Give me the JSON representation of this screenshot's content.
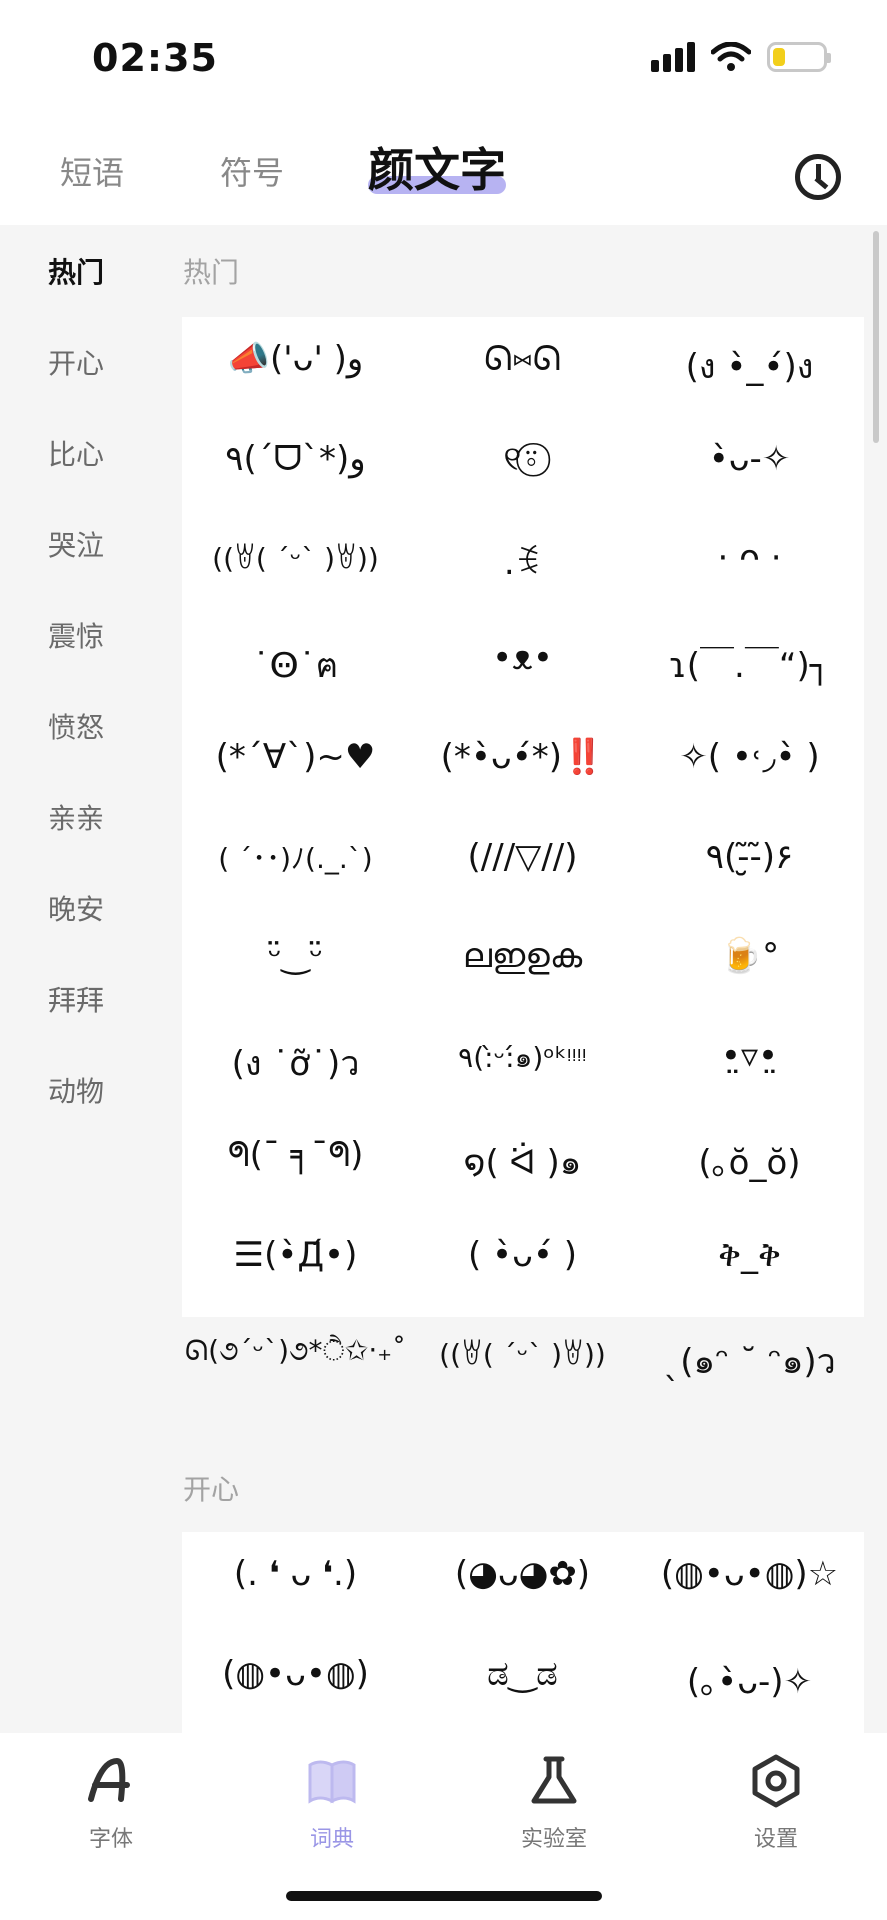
{
  "status": {
    "time": "02:35"
  },
  "tabs": {
    "phrases": "短语",
    "symbols": "符号",
    "kaomoji": "颜文字"
  },
  "sidebar": {
    "items": [
      "热门",
      "开心",
      "比心",
      "哭泣",
      "震惊",
      "愤怒",
      "亲亲",
      "晚安",
      "拜拜",
      "动物"
    ],
    "active": "热门"
  },
  "sections": [
    {
      "title": "热门",
      "items": [
        "📣('ᴗ' )و",
        "ᘏ⑅ᘏ",
        "(ง •̀_•́)ง",
        "٩(ˊᗜˋ*)و",
        "୧⍤⃝",
        "•̀ᴗ-✧",
        "((ꇐ( ˊᵕˋ )ꇐ))",
        ".ꉂ",
        "· ᴖ ·",
        "˙Ꙫ˙ฅ",
        "•ᴥ•",
        "ɿ(￣.￣“)┐",
        "(*´∀`)~♥",
        "(*•̀ᴗ•́*)‼️",
        "✧( •˓◞•̀ )",
        "( ´･･)ﾉ(._.`)",
        "(///▽//)",
        "٩(-̮̮̃-̃)۶",
        "ᵕ̈‿ᵕ̈",
        "ലഇഉക",
        "🍺°",
        "(ง ˙ỡ˙)ว",
        "٩(:̀ᵕ:́๑)ᵒᵏᵎᵎᵎᵎ",
        "•̤▿•̤",
        "ᖗ(¯ ╕¯ᖗ)",
        "໑( ᐛ )๑",
        "(｡ŏ_ŏ)",
        "☰(•̀Дּ•́)",
        "( •̀ᴗ•́ )",
        "ቅ_ቅ",
        "ᘏ(૭ˊᵕˋ)૭*ੈ✩‧₊˚",
        "((ꇐ( ˊᵕˋ )ꇐ))",
        "ˎ(๑ᵔ ˘ ᵔ๑)ว"
      ]
    },
    {
      "title": "开心",
      "items": [
        "(. ❛ ᴗ ❛.)",
        "(◕ᴗ◕✿)",
        "(◍•ᴗ•◍)☆",
        "(◍•ᴗ•◍)",
        "ಡ‿ಡ",
        "(｡•̀ᴗ-)✧"
      ]
    }
  ],
  "nav": [
    {
      "label": "字体",
      "icon": "font-icon"
    },
    {
      "label": "词典",
      "icon": "book-icon"
    },
    {
      "label": "实验室",
      "icon": "flask-icon"
    },
    {
      "label": "设置",
      "icon": "settings-icon"
    }
  ],
  "colors": {
    "accent": "#9a96e6",
    "highlight": "#b7b3f2",
    "battery": "#f2cf1b"
  }
}
